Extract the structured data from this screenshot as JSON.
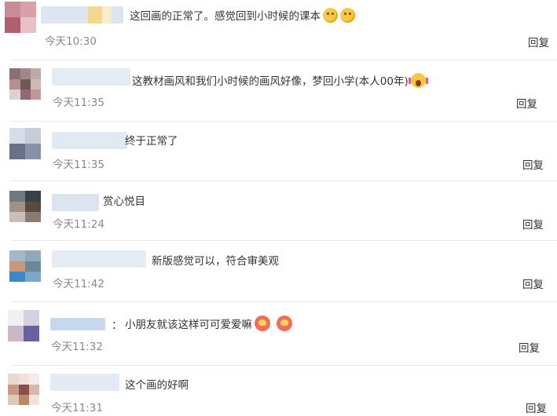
{
  "comments": [
    {
      "text": "这回画的正常了。感觉回到小时候的课本",
      "time": "今天10:30",
      "reply": "回复",
      "emojis": [
        "thinking-face-icon",
        "thinking-face-icon"
      ]
    },
    {
      "text": "这教材画风和我们小时候的画风好像，梦回小学(本人00年)",
      "time": "今天11:35",
      "reply": "回复",
      "emojis": [
        "screaming-face-icon"
      ]
    },
    {
      "text": "终于正常了",
      "time": "今天11:35",
      "reply": "回复",
      "emojis": []
    },
    {
      "text": "赏心悦目",
      "time": "今天11:24",
      "reply": "回复",
      "emojis": []
    },
    {
      "text": "新版感觉可以，符合审美观",
      "time": "今天11:42",
      "reply": "回复",
      "emojis": []
    },
    {
      "text": "小朋友就该这样可可爱爱嘛",
      "prefix": "：",
      "time": "今天11:32",
      "reply": "回复",
      "emojis": [
        "kissing-heart-icon",
        "kissing-heart-icon"
      ]
    },
    {
      "text": "这个画的好啊",
      "time": "今天11:31",
      "reply": "回复",
      "emojis": []
    }
  ]
}
